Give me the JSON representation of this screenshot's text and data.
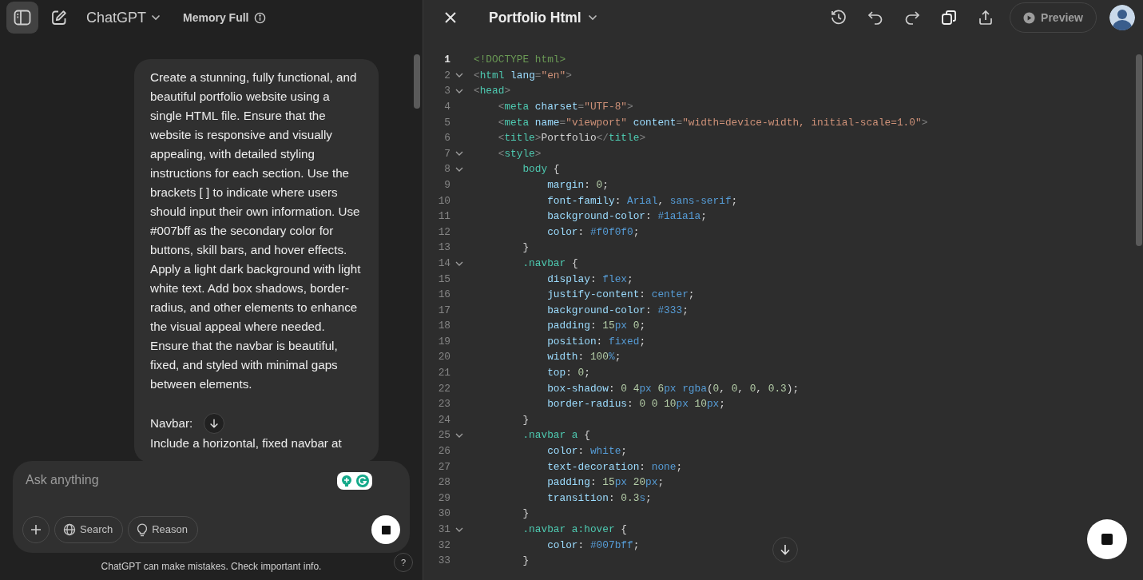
{
  "header": {
    "model": "ChatGPT",
    "memory_status": "Memory Full"
  },
  "message": {
    "blocks": [
      {
        "lines": [
          "Create a stunning, fully functional, and beautiful portfolio website using a single HTML file. Ensure that the website is responsive and visually appealing, with detailed styling instructions for each section. Use the brackets [ ] to indicate where users should input their own information. Use #007bff as the secondary color for buttons, skill bars, and hover effects. Apply a light dark background with light white text. Add box shadows, border-radius, and other elements to enhance the visual appeal where needed. Ensure that the navbar is beautiful, fixed, and styled with minimal gaps between elements."
        ]
      },
      {
        "lines": [
          "Navbar:",
          "Include a horizontal, fixed navbar at"
        ]
      }
    ]
  },
  "composer": {
    "placeholder": "Ask anything",
    "tools": [
      {
        "kind": "search",
        "label": "Search"
      },
      {
        "kind": "reason",
        "label": "Reason"
      }
    ]
  },
  "disclaimer": "ChatGPT can make mistakes. Check important info.",
  "help": "?",
  "canvas": {
    "title": "Portfolio Html",
    "preview": "Preview",
    "code": [
      {
        "number": "1",
        "active": true,
        "foldable": false,
        "text": "<!DOCTYPE html>"
      },
      {
        "number": "2",
        "active": false,
        "foldable": true,
        "text": "<html lang=\"en\">"
      },
      {
        "number": "3",
        "active": false,
        "foldable": true,
        "text": "<head>"
      },
      {
        "number": "4",
        "active": false,
        "foldable": false,
        "text": "    <meta charset=\"UTF-8\">"
      },
      {
        "number": "5",
        "active": false,
        "foldable": false,
        "text": "    <meta name=\"viewport\" content=\"width=device-width, initial-scale=1.0\">"
      },
      {
        "number": "6",
        "active": false,
        "foldable": false,
        "text": "    <title>Portfolio</title>"
      },
      {
        "number": "7",
        "active": false,
        "foldable": true,
        "text": "    <style>"
      },
      {
        "number": "8",
        "active": false,
        "foldable": true,
        "text": "        body {"
      },
      {
        "number": "9",
        "active": false,
        "foldable": false,
        "text": "            margin: 0;"
      },
      {
        "number": "10",
        "active": false,
        "foldable": false,
        "text": "            font-family: Arial, sans-serif;"
      },
      {
        "number": "11",
        "active": false,
        "foldable": false,
        "text": "            background-color: #1a1a1a;"
      },
      {
        "number": "12",
        "active": false,
        "foldable": false,
        "text": "            color: #f0f0f0;"
      },
      {
        "number": "13",
        "active": false,
        "foldable": false,
        "text": "        }"
      },
      {
        "number": "14",
        "active": false,
        "foldable": true,
        "text": "        .navbar {"
      },
      {
        "number": "15",
        "active": false,
        "foldable": false,
        "text": "            display: flex;"
      },
      {
        "number": "16",
        "active": false,
        "foldable": false,
        "text": "            justify-content: center;"
      },
      {
        "number": "17",
        "active": false,
        "foldable": false,
        "text": "            background-color: #333;"
      },
      {
        "number": "18",
        "active": false,
        "foldable": false,
        "text": "            padding: 15px 0;"
      },
      {
        "number": "19",
        "active": false,
        "foldable": false,
        "text": "            position: fixed;"
      },
      {
        "number": "20",
        "active": false,
        "foldable": false,
        "text": "            width: 100%;"
      },
      {
        "number": "21",
        "active": false,
        "foldable": false,
        "text": "            top: 0;"
      },
      {
        "number": "22",
        "active": false,
        "foldable": false,
        "text": "            box-shadow: 0 4px 6px rgba(0, 0, 0, 0.3);"
      },
      {
        "number": "23",
        "active": false,
        "foldable": false,
        "text": "            border-radius: 0 0 10px 10px;"
      },
      {
        "number": "24",
        "active": false,
        "foldable": false,
        "text": "        }"
      },
      {
        "number": "25",
        "active": false,
        "foldable": true,
        "text": "        .navbar a {"
      },
      {
        "number": "26",
        "active": false,
        "foldable": false,
        "text": "            color: white;"
      },
      {
        "number": "27",
        "active": false,
        "foldable": false,
        "text": "            text-decoration: none;"
      },
      {
        "number": "28",
        "active": false,
        "foldable": false,
        "text": "            padding: 15px 20px;"
      },
      {
        "number": "29",
        "active": false,
        "foldable": false,
        "text": "            transition: 0.3s;"
      },
      {
        "number": "30",
        "active": false,
        "foldable": false,
        "text": "        }"
      },
      {
        "number": "31",
        "active": false,
        "foldable": true,
        "text": "        .navbar a:hover {"
      },
      {
        "number": "32",
        "active": false,
        "foldable": false,
        "text": "            color: #007bff;"
      },
      {
        "number": "33",
        "active": false,
        "foldable": false,
        "text": "        }"
      }
    ]
  }
}
